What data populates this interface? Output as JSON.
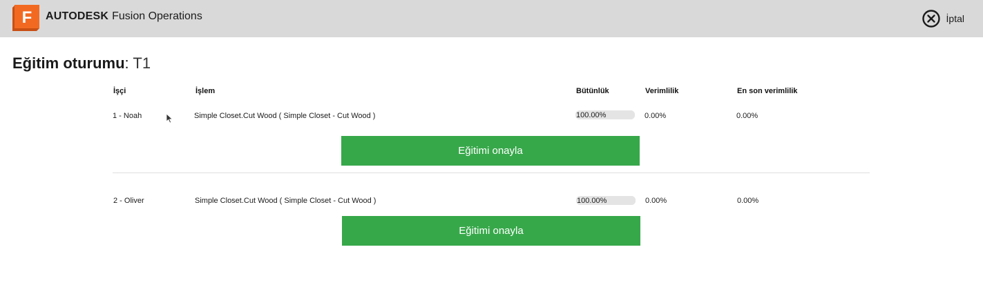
{
  "app": {
    "brand_bold": "AUTODESK",
    "brand_rest": "Fusion Operations",
    "logo_letter": "F",
    "logo_icon": "fusion-operations-logo-icon",
    "cancel_label": "İptal",
    "cancel_icon": "circle-x-icon"
  },
  "session": {
    "label": "Eğitim oturumu",
    "separator": ": ",
    "value": "T1"
  },
  "columns": {
    "worker": "İşçi",
    "operation": "İşlem",
    "completeness": "Bütünlük",
    "efficiency": "Verimlilik",
    "last_efficiency": "En son verimlilik"
  },
  "rows": [
    {
      "worker": "1 - Noah",
      "operation": "Simple Closet.Cut Wood ( Simple Closet - Cut Wood )",
      "completeness": "100.00%",
      "completeness_fraction": 1.0,
      "efficiency": "0.00%",
      "last_efficiency": "0.00%",
      "confirm_label": "Eğitimi onayla"
    },
    {
      "worker": "2 - Oliver",
      "operation": "Simple Closet.Cut Wood ( Simple Closet - Cut Wood )",
      "completeness": "100.00%",
      "completeness_fraction": 1.0,
      "efficiency": "0.00%",
      "last_efficiency": "0.00%",
      "confirm_label": "Eğitimi onayla"
    }
  ],
  "colors": {
    "header_bg": "#d9d9d9",
    "confirm_green": "#37a84a",
    "logo_orange": "#f26a21",
    "logo_orange_dark": "#c94f14",
    "progress_track": "#e4e4e4",
    "progress_fill": "#e4e4e4"
  }
}
